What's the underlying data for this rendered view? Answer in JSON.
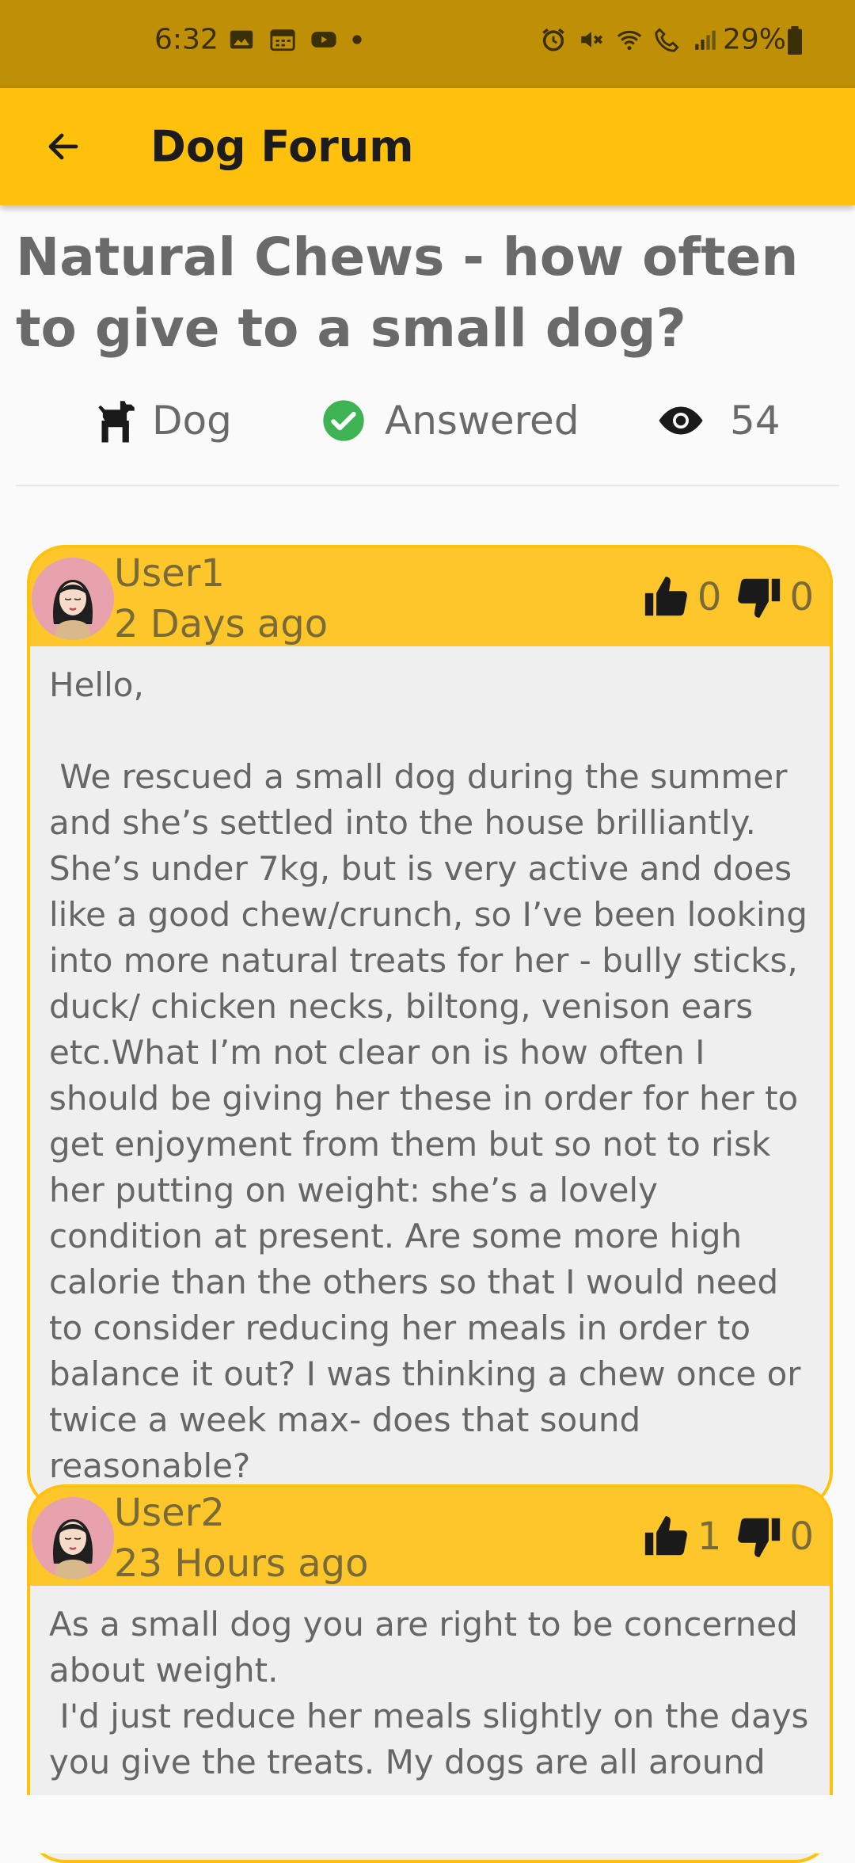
{
  "status_bar": {
    "time": "6:32",
    "battery": "29%",
    "left_icons": [
      "image-icon",
      "calendar-icon",
      "youtube-icon",
      "dot-icon"
    ],
    "right_icons": [
      "alarm-icon",
      "mute-icon",
      "wifi-icon",
      "wifi-call-icon",
      "signal-icon",
      "battery-icon"
    ]
  },
  "app_bar": {
    "title": "Dog Forum",
    "back_icon": "arrow-left-icon"
  },
  "post": {
    "title": "Natural Chews - how often to give to a small dog?",
    "category": "Dog",
    "status": "Answered",
    "views": "54"
  },
  "colors": {
    "accent": "#ffc10b",
    "status_bar": "#bf8f05",
    "answered": "#3db353",
    "card_header": "#fdc72b"
  },
  "replies": [
    {
      "user": "User1",
      "time": "2 Days ago",
      "likes": "0",
      "dislikes": "0",
      "text": "Hello,\n\n We rescued a small dog during the summer and she’s settled into the house brilliantly. She’s under 7kg, but is very active and does like a good chew/crunch, so I’ve been looking into more natural treats for her - bully sticks, duck/ chicken necks, biltong, venison ears etc.What I’m not clear on is how often I should be giving her these in order for her to get enjoyment from them but so not to risk her putting on weight: she’s a lovely condition at present. Are some more high calorie than the others so that I would need to consider reducing her meals in order to balance it out? I was thinking a chew once or twice a week max- does that sound reasonable?"
    },
    {
      "user": "User2",
      "time": "23 Hours ago",
      "likes": "1",
      "dislikes": "0",
      "text": "As a small dog you are right to be concerned about weight.\n I'd just reduce her meals slightly on the days you give the treats. My dogs are all around"
    }
  ]
}
